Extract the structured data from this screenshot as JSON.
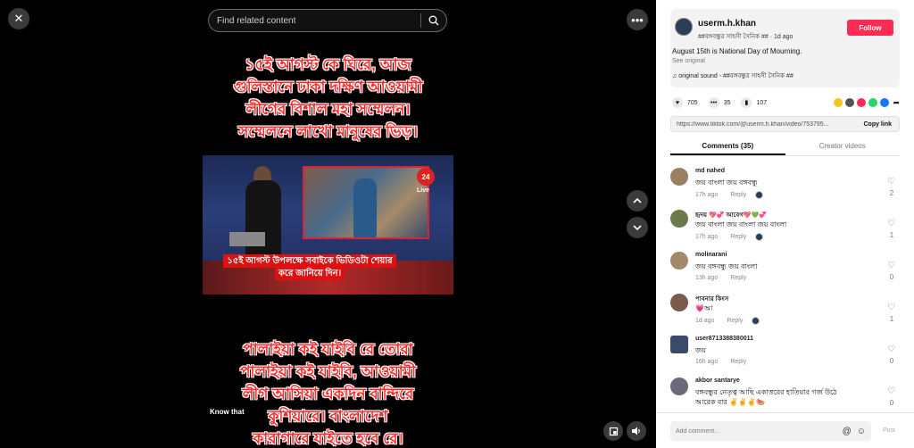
{
  "colors": {
    "accent": "#fe2c55",
    "video_text": "#ff2a2a",
    "caption_bg": "#d11"
  },
  "video": {
    "search_placeholder": "Find related content",
    "top_caption": [
      "১৫ই আগস্ট কে ঘিরে, আজ",
      "গুলিস্তানে ঢাকা দক্ষিণ আওয়ামী",
      "লীগের বিশাল  মহা  সম্মেলন।",
      "সম্মেলনে লাখো মানুষের ভিড়।"
    ],
    "tv_logo": "24",
    "tv_live": "Live",
    "tv_lower_third": [
      "১৫ই আগস্ট উপলক্ষে সবাইকে ভিডিওটা শেয়ার",
      "করে জানিয়ে দিন।"
    ],
    "bottom_caption": [
      "পালাইয়া কই যাইবি রে তোরা",
      "পালাইয়া কই যাইবি, আওয়ামী",
      "লীগ আসিয়া একদিন বান্দিরে",
      "কুশিয়ারে। বাংলাদেশ",
      "কারাগারে যাইতে হবে রে।"
    ],
    "overlay_label": "Know that",
    "icons": {
      "close": "close-icon",
      "more": "more-icon",
      "search": "search-icon",
      "up": "chevron-up-icon",
      "down": "chevron-down-icon",
      "pip": "pip-icon",
      "volume": "volume-icon"
    }
  },
  "author": {
    "username": "userm.h.khan",
    "handle": "##বঙ্গবন্ধুর সাহসী সৈনিক ##",
    "time": "1d ago",
    "follow_label": "Follow",
    "description": "August 15th is National Day of Mourning.",
    "see_original": "See original",
    "sound": "original sound - ##বঙ্গবন্ধুর সাহসী সৈনিক ##"
  },
  "stats": {
    "likes": "705",
    "comments": "35",
    "saves": "107"
  },
  "share_colors": [
    "#f5c518",
    "#555555",
    "#fe2c55",
    "#25d366",
    "#1877f2"
  ],
  "link": {
    "url": "https://www.tiktok.com/@userm.h.khan/video/753795...",
    "copy_label": "Copy link"
  },
  "tabs": [
    {
      "label": "Comments (35)"
    },
    {
      "label": "Creator videos"
    }
  ],
  "comments": [
    {
      "name": "md nahed",
      "text": "জয় বাংলা জয় বঙ্গবন্ধু",
      "time": "17h ago",
      "reply": "Reply",
      "likes": "2",
      "avatar_color": "#9a8060"
    },
    {
      "name": "হৃদয় 💖💞 আবেগ💖💚💞",
      "text": "জয় বাংলা জয় বাংলা জয় বাংলা",
      "time": "17h ago",
      "reply": "Reply",
      "likes": "1",
      "avatar_color": "#6a7a4a"
    },
    {
      "name": "molinarani",
      "text": "জয় বঙ্গবন্ধু জয় বাংলা",
      "time": "13h ago",
      "reply": "Reply",
      "likes": "0",
      "avatar_color": "#a58a6a"
    },
    {
      "name": "পাবনার কিংস",
      "text": "💗আ",
      "time": "1d ago",
      "reply": "Reply",
      "likes": "1",
      "avatar_color": "#7a5a4a"
    },
    {
      "name": "user8713388380011",
      "text": "জয়",
      "time": "16h ago",
      "reply": "Reply",
      "likes": "0",
      "avatar_color": "#3a4a6a"
    },
    {
      "name": "akbor santarye",
      "text": "বঙ্গবন্ধুর নেতৃত্ব আছি একাত্তরের হাতিয়ার গর্জ উঠে",
      "text2": "আরেক বার ✌️✌️✌️🍉",
      "time": "",
      "reply": "",
      "likes": "0",
      "avatar_color": "#6a6a7a"
    }
  ],
  "comment_box": {
    "placeholder": "Add comment...",
    "post_label": "Post"
  }
}
